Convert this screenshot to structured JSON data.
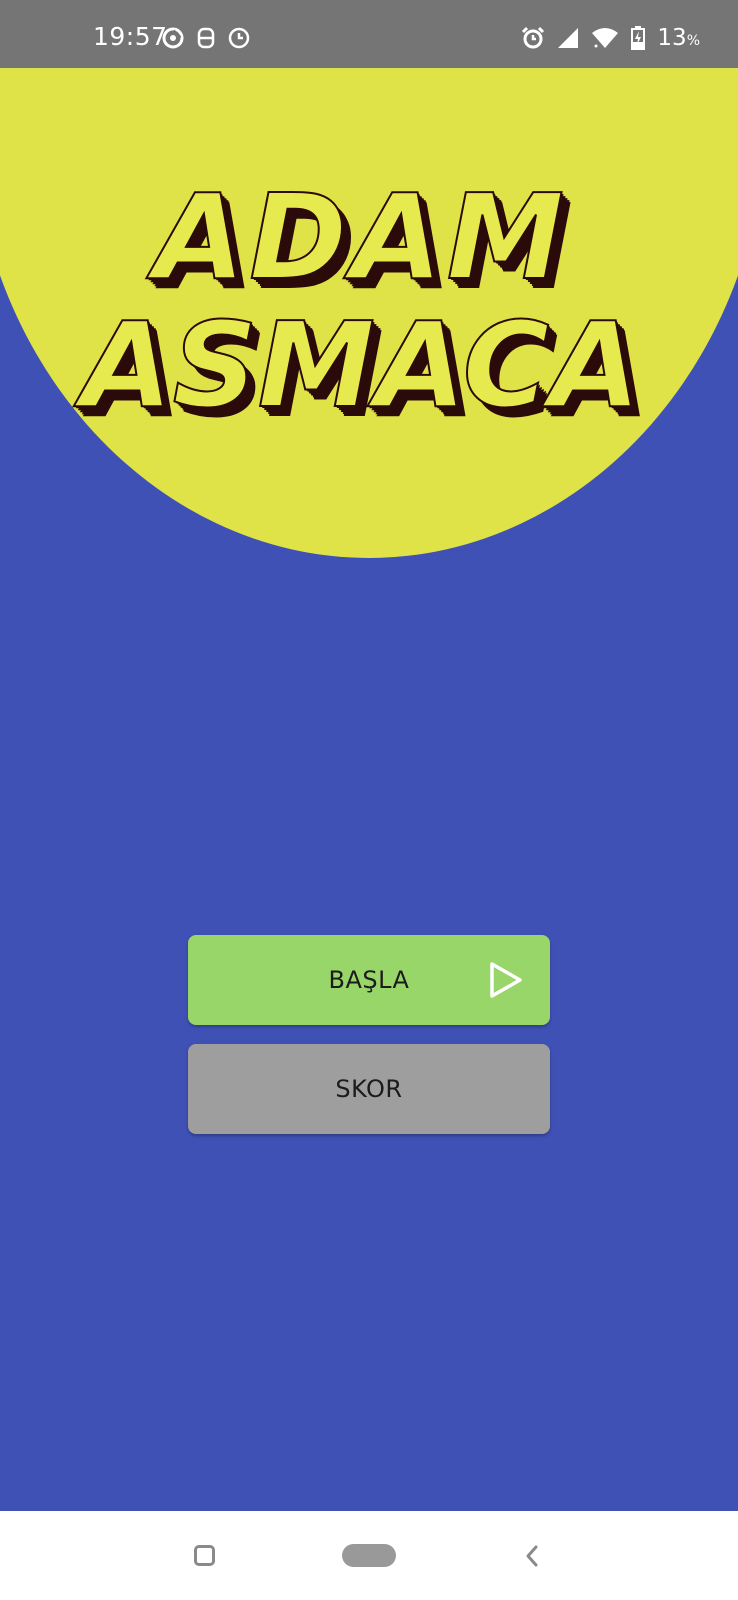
{
  "status_bar": {
    "time": "19:57",
    "battery_percent": "13",
    "battery_unit": "%",
    "left_icons": [
      "notification-app-icon",
      "sim-toolkit-icon",
      "clock-icon"
    ],
    "right_icons": [
      "alarm-icon",
      "cell-signal-icon",
      "wifi-icon",
      "battery-charging-icon"
    ]
  },
  "title": {
    "line1": "ADAM",
    "line2": "ASMACA"
  },
  "buttons": {
    "start_label": "BAŞLA",
    "score_label": "SKOR"
  },
  "colors": {
    "background": "#3f51b5",
    "header_circle": "#dfe348",
    "title_fill": "#e7ea4f",
    "title_shadow": "#2b0a0a",
    "start_button": "#99d669",
    "score_button": "#9e9e9e",
    "status_bar": "#757575"
  },
  "navigation": {
    "items": [
      "recents-button",
      "home-button",
      "back-button"
    ]
  }
}
